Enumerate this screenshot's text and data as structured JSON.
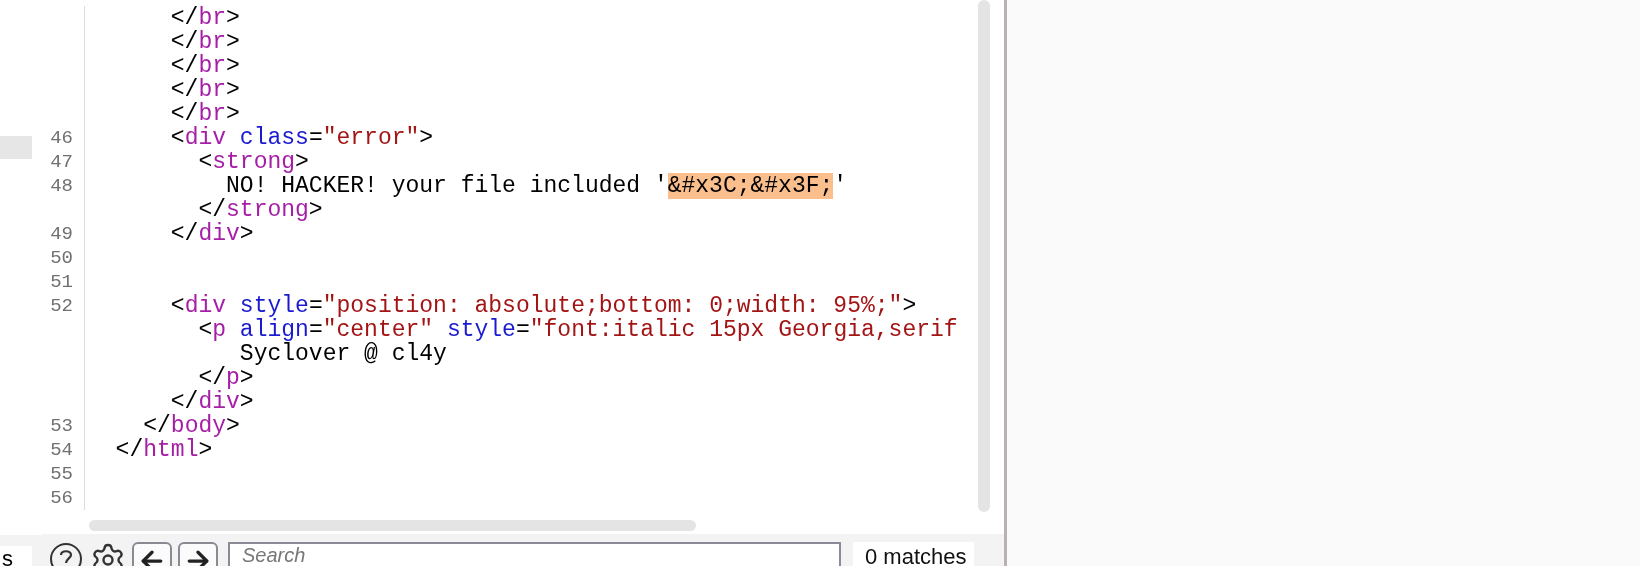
{
  "left_panel": {
    "label": "s"
  },
  "editor": {
    "lines": [
      {
        "segments": [
          {
            "kind": "punct",
            "text": "      </"
          },
          {
            "kind": "tag",
            "text": "br"
          },
          {
            "kind": "punct",
            "text": ">"
          }
        ]
      },
      {
        "segments": [
          {
            "kind": "punct",
            "text": "      </"
          },
          {
            "kind": "tag",
            "text": "br"
          },
          {
            "kind": "punct",
            "text": ">"
          }
        ]
      },
      {
        "segments": [
          {
            "kind": "punct",
            "text": "      </"
          },
          {
            "kind": "tag",
            "text": "br"
          },
          {
            "kind": "punct",
            "text": ">"
          }
        ]
      },
      {
        "segments": [
          {
            "kind": "punct",
            "text": "      </"
          },
          {
            "kind": "tag",
            "text": "br"
          },
          {
            "kind": "punct",
            "text": ">"
          }
        ]
      },
      {
        "segments": [
          {
            "kind": "punct",
            "text": "      </"
          },
          {
            "kind": "tag",
            "text": "br"
          },
          {
            "kind": "punct",
            "text": ">"
          }
        ]
      },
      {
        "number": "46",
        "segments": [
          {
            "kind": "punct",
            "text": "      <"
          },
          {
            "kind": "tag",
            "text": "div"
          },
          {
            "kind": "attr",
            "text": " class"
          },
          {
            "kind": "punct",
            "text": "="
          },
          {
            "kind": "value",
            "text": "\"error\""
          },
          {
            "kind": "punct",
            "text": ">"
          }
        ]
      },
      {
        "number": "47",
        "segments": [
          {
            "kind": "punct",
            "text": "        <"
          },
          {
            "kind": "tag",
            "text": "strong"
          },
          {
            "kind": "punct",
            "text": ">"
          }
        ]
      },
      {
        "number": "48",
        "segments": [
          {
            "kind": "text",
            "text": "          NO! HACKER! your file included '"
          },
          {
            "kind": "match",
            "text": "&#x3C;&#x3F;"
          },
          {
            "kind": "text",
            "text": "'"
          }
        ]
      },
      {
        "segments": [
          {
            "kind": "punct",
            "text": "        </"
          },
          {
            "kind": "tag",
            "text": "strong"
          },
          {
            "kind": "punct",
            "text": ">"
          }
        ]
      },
      {
        "number": "49",
        "segments": [
          {
            "kind": "punct",
            "text": "      </"
          },
          {
            "kind": "tag",
            "text": "div"
          },
          {
            "kind": "punct",
            "text": ">"
          }
        ]
      },
      {
        "number": "50"
      },
      {
        "number": "51"
      },
      {
        "number": "52",
        "segments": [
          {
            "kind": "punct",
            "text": "      <"
          },
          {
            "kind": "tag",
            "text": "div"
          },
          {
            "kind": "attr",
            "text": " style"
          },
          {
            "kind": "punct",
            "text": "="
          },
          {
            "kind": "value",
            "text": "\"position: absolute;bottom: 0;width: 95%;\""
          },
          {
            "kind": "punct",
            "text": ">"
          }
        ]
      },
      {
        "segments": [
          {
            "kind": "punct",
            "text": "        <"
          },
          {
            "kind": "tag",
            "text": "p"
          },
          {
            "kind": "attr",
            "text": " align"
          },
          {
            "kind": "punct",
            "text": "="
          },
          {
            "kind": "value",
            "text": "\"center\""
          },
          {
            "kind": "attr",
            "text": " style"
          },
          {
            "kind": "punct",
            "text": "="
          },
          {
            "kind": "value",
            "text": "\"font:italic 15px Georgia,serif"
          }
        ]
      },
      {
        "segments": [
          {
            "kind": "text",
            "text": "           Syclover @ cl4y"
          }
        ]
      },
      {
        "segments": [
          {
            "kind": "punct",
            "text": "        </"
          },
          {
            "kind": "tag",
            "text": "p"
          },
          {
            "kind": "punct",
            "text": ">"
          }
        ]
      },
      {
        "segments": [
          {
            "kind": "punct",
            "text": "      </"
          },
          {
            "kind": "tag",
            "text": "div"
          },
          {
            "kind": "punct",
            "text": ">"
          }
        ]
      },
      {
        "number": "53",
        "segments": [
          {
            "kind": "punct",
            "text": "    </"
          },
          {
            "kind": "tag",
            "text": "body"
          },
          {
            "kind": "punct",
            "text": ">"
          }
        ]
      },
      {
        "number": "54",
        "segments": [
          {
            "kind": "punct",
            "text": "  </"
          },
          {
            "kind": "tag",
            "text": "html"
          },
          {
            "kind": "punct",
            "text": ">"
          }
        ]
      },
      {
        "number": "55"
      },
      {
        "number": "56"
      }
    ]
  },
  "toolbar": {
    "search": {
      "placeholder": "Search"
    },
    "matches": "0 matches"
  }
}
